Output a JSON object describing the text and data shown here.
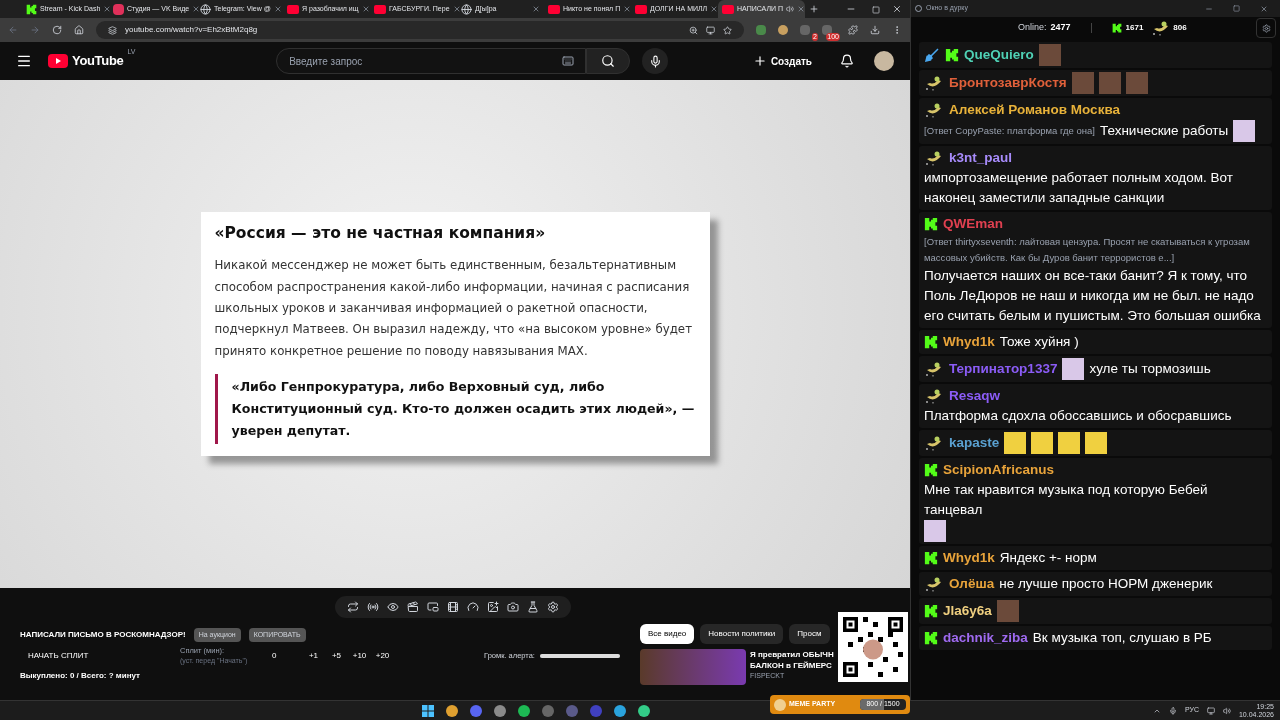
{
  "browser": {
    "tabs": [
      {
        "kind": "kick",
        "title": "Stream - Kick Dash",
        "selected": false
      },
      {
        "kind": "vk",
        "title": "Студия — VK Виде",
        "selected": false
      },
      {
        "kind": "globe",
        "title": "Telegram: View @",
        "selected": false
      },
      {
        "kind": "youtube",
        "title": "Я разоблачил ищ",
        "selected": false
      },
      {
        "kind": "youtube",
        "title": "ГАБСБУРГИ. Пере",
        "selected": false
      },
      {
        "kind": "globe",
        "title": "Д[ы]ра",
        "selected": false
      },
      {
        "kind": "youtube",
        "title": "Никто не понял П",
        "selected": false
      },
      {
        "kind": "youtube",
        "title": "ДОЛГИ НА МИЛЛ",
        "selected": false
      },
      {
        "kind": "youtube",
        "title": "НАПИСАЛИ П",
        "selected": true
      }
    ],
    "url": "youtube.com/watch?v=Eh2xBtM2q8g",
    "extension_badges": [
      "2",
      "100"
    ]
  },
  "youtube": {
    "logo_text": "YouTube",
    "region": "LV",
    "search": {
      "placeholder": "Введите запрос"
    },
    "create_label": "Создать",
    "article": {
      "title": "«Россия — это не частная компания»",
      "paragraph": "Никакой мессенджер не может быть единственным, безальтернативным способом распространения какой-либо информации, начиная с расписания школьных уроков и заканчивая информацией о ракетной опасности, подчеркнул Матвеев. Он выразил надежду, что «на высоком уровне» будет принято конкретное решение по поводу навязывания MAX.",
      "quote": "«Либо Генпрокуратура, либо Верховный суд, либо Конституционный суд. Кто-то должен осадить этих людей», — уверен депутат."
    },
    "panel": {
      "title": "НАПИСАЛИ ПИСЬМО В РОСКОМНАДЗОР!",
      "auction_button": "На аукцион",
      "copy_button": "КОПИРОВАТЬ",
      "split_button": "НАЧАТЬ СПЛИТ",
      "split_label": "Сплит (мин):",
      "split_hint": "(уст. перед \"Начать\")",
      "split_value": "0",
      "increments": [
        "+1",
        "+5",
        "+10",
        "+20"
      ],
      "alert_volume_label": "Громк. алерта:",
      "alert_volume": {
        "level": 1
      },
      "summary": "Выкуплено: 0 / Всего: ? минут"
    },
    "chips": [
      {
        "label": "Все видео",
        "selected": true
      },
      {
        "label": "Новости политики",
        "selected": false
      },
      {
        "label": "Просм",
        "selected": false
      }
    ],
    "suggestion": {
      "title_lines": [
        "Я превратил ОБЫЧН",
        "БАЛКОН в ГЕЙМЕРС"
      ],
      "channel": "FISPECKT"
    }
  },
  "meme_party": {
    "label": "MEME PARTY",
    "progress": "800 / 1500",
    "level": 0.53
  },
  "chat": {
    "window_title": "Окно в дурку",
    "online_label": "Online:",
    "online": "2477",
    "kick_count": "1671",
    "vk_count": "806",
    "messages": [
      {
        "kind": "kick",
        "moderator": true,
        "name": "QueQuiero",
        "color": "#4fd1b5",
        "content": [
          {
            "kind": "photo"
          }
        ]
      },
      {
        "kind": "vk",
        "moderator": false,
        "name": "БронтозаврКостя",
        "color": "#e0603a",
        "content": [
          {
            "kind": "photo"
          },
          {
            "kind": "photo"
          },
          {
            "kind": "photo"
          }
        ]
      },
      {
        "kind": "vk",
        "moderator": false,
        "name": "Алексей Романов Москва",
        "color": "#e8b23a",
        "reply": "[Ответ CopyPaste: платформа  где она]",
        "content": [
          {
            "kind": "text",
            "text": "Технические работы"
          },
          {
            "kind": "cartoon"
          }
        ]
      },
      {
        "kind": "vk",
        "moderator": false,
        "name": "k3nt_paul",
        "color": "#a78bfa",
        "content": [
          {
            "kind": "text",
            "text": "импортозамещение работает полным ходом. Вот наконец заместили западные санкции"
          }
        ]
      },
      {
        "kind": "kick",
        "moderator": false,
        "name": "QWEman",
        "color": "#e04050",
        "reply": "[Ответ thirtyxseventh: лайтовая цензура. Просят не скатываться к угрозам массовых убийств. Как бы Дуров банит террористов е...]",
        "content": [
          {
            "kind": "text",
            "text": "Получается наших он все-таки банит? Я к тому, что Поль ЛеДюров не наш и никогда им не был. не надо его считать белым и пушистым. Это большая ошибка"
          }
        ]
      },
      {
        "kind": "kick",
        "moderator": false,
        "name": "Whyd1k",
        "color": "#e8a33a",
        "content": [
          {
            "kind": "text",
            "text": "Тоже хуйня )"
          }
        ]
      },
      {
        "kind": "vk",
        "moderator": false,
        "name": "Терпинатор1337",
        "color": "#8b5cf6",
        "content": [
          {
            "kind": "cartoon"
          },
          {
            "kind": "text",
            "text": "хуле ты тормозишь"
          }
        ]
      },
      {
        "kind": "vk",
        "moderator": false,
        "name": "Resaqw",
        "color": "#8b5cf6",
        "content": [
          {
            "kind": "text",
            "text": "Платформа сдохла обоссавшись и обосравшись"
          }
        ]
      },
      {
        "kind": "vk",
        "moderator": false,
        "name": "kapaste",
        "color": "#5aa0d0",
        "content": [
          {
            "kind": "smiley"
          },
          {
            "kind": "smiley"
          },
          {
            "kind": "smiley"
          },
          {
            "kind": "smiley"
          }
        ]
      },
      {
        "kind": "kick",
        "moderator": false,
        "name": "ScipionAfricanus",
        "color": "#e8a33a",
        "content": [
          {
            "kind": "text",
            "text": "Мне так нравится музыка под которую Бебей танцевал"
          },
          {
            "kind": "cartoon"
          }
        ]
      },
      {
        "kind": "kick",
        "moderator": false,
        "name": "Whyd1k",
        "color": "#e8a33a",
        "content": [
          {
            "kind": "text",
            "text": "Яндекс +- норм"
          }
        ]
      },
      {
        "kind": "vk",
        "moderator": false,
        "name": "Олёша",
        "color": "#e8a33a",
        "content": [
          {
            "kind": "text",
            "text": "не лучше просто НОРМ дженерик"
          }
        ]
      },
      {
        "kind": "kick",
        "moderator": false,
        "name": "Jla6y6a",
        "color": "#f0d080",
        "content": [
          {
            "kind": "photo"
          }
        ]
      },
      {
        "kind": "kick",
        "moderator": false,
        "name": "dachnik_ziba",
        "color": "#9f6af0",
        "content": [
          {
            "kind": "text",
            "text": "Вк музыка топ, слушаю в РБ"
          }
        ]
      }
    ]
  },
  "taskbar": {
    "language": "РУС",
    "time": "19:25",
    "date": "10.04.2026"
  }
}
